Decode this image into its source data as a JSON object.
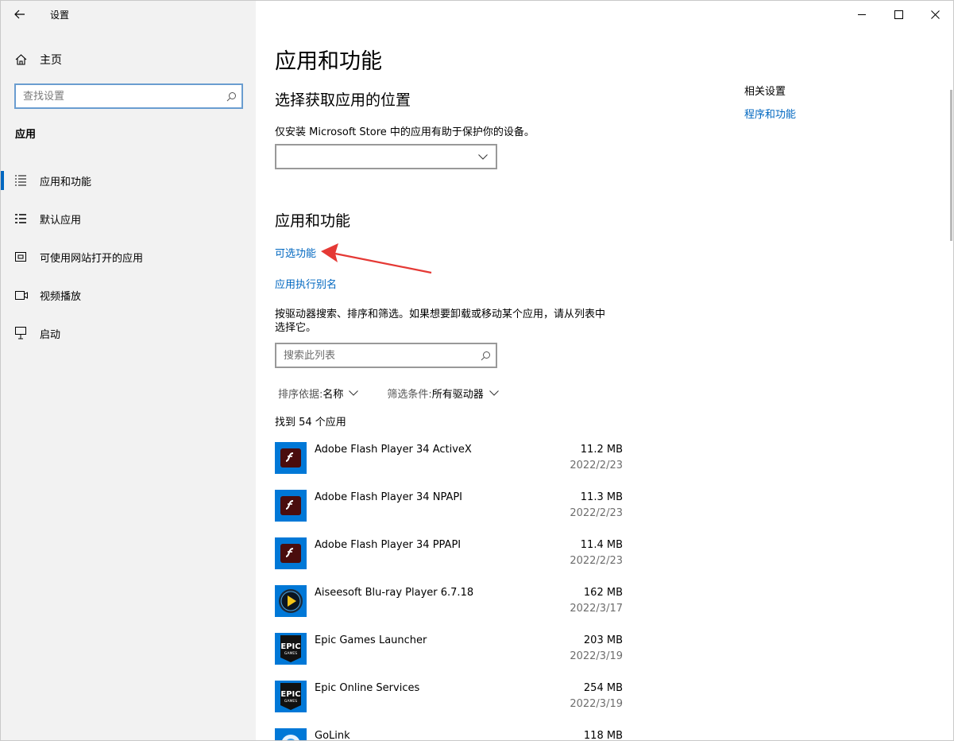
{
  "window": {
    "title": "设置",
    "controls": [
      "minimize-icon",
      "maximize-icon",
      "close-icon"
    ]
  },
  "sidebar": {
    "home_label": "主页",
    "search_placeholder": "查找设置",
    "section": "应用",
    "items": [
      {
        "label": "应用和功能",
        "icon": "list-icon",
        "active": true
      },
      {
        "label": "默认应用",
        "icon": "default-apps-icon",
        "active": false
      },
      {
        "label": "可使用网站打开的应用",
        "icon": "website-apps-icon",
        "active": false
      },
      {
        "label": "视频播放",
        "icon": "video-icon",
        "active": false
      },
      {
        "label": "启动",
        "icon": "startup-icon",
        "active": false
      }
    ]
  },
  "main": {
    "title": "应用和功能",
    "source_heading": "选择获取应用的位置",
    "source_desc": "仅安装 Microsoft Store 中的应用有助于保护你的设备。",
    "source_value": "",
    "apps_heading": "应用和功能",
    "optional_features_link": "可选功能",
    "app_alias_link": "应用执行别名",
    "search_desc_line1": "按驱动器搜索、排序和筛选。如果想要卸载或移动某个应用，请从列表中",
    "search_desc_line2": "选择它。",
    "list_search_placeholder": "搜索此列表",
    "sort_key": "排序依据: ",
    "sort_value": "名称",
    "filter_key": "筛选条件: ",
    "filter_value": "所有驱动器",
    "count_text": "找到 54 个应用",
    "related_title": "相关设置",
    "related_link": "程序和功能"
  },
  "apps": [
    {
      "name": "Adobe Flash Player 34 ActiveX",
      "size": "11.2 MB",
      "date": "2022/2/23",
      "icon": "flash-icon"
    },
    {
      "name": "Adobe Flash Player 34 NPAPI",
      "size": "11.3 MB",
      "date": "2022/2/23",
      "icon": "flash-icon"
    },
    {
      "name": "Adobe Flash Player 34 PPAPI",
      "size": "11.4 MB",
      "date": "2022/2/23",
      "icon": "flash-icon"
    },
    {
      "name": "Aiseesoft Blu-ray Player 6.7.18",
      "size": "162 MB",
      "date": "2022/3/17",
      "icon": "bluray-player-icon"
    },
    {
      "name": "Epic Games Launcher",
      "size": "203 MB",
      "date": "2022/3/19",
      "icon": "epic-games-icon"
    },
    {
      "name": "Epic Online Services",
      "size": "254 MB",
      "date": "2022/3/19",
      "icon": "epic-games-icon"
    },
    {
      "name": "GoLink",
      "size": "118 MB",
      "date": "",
      "icon": "golink-icon"
    }
  ],
  "colors": {
    "accent": "#0067c0",
    "sidebar_bg": "#f2f2f2",
    "annotation_arrow": "#e53935",
    "app_tile_bg": "#0078d7"
  }
}
